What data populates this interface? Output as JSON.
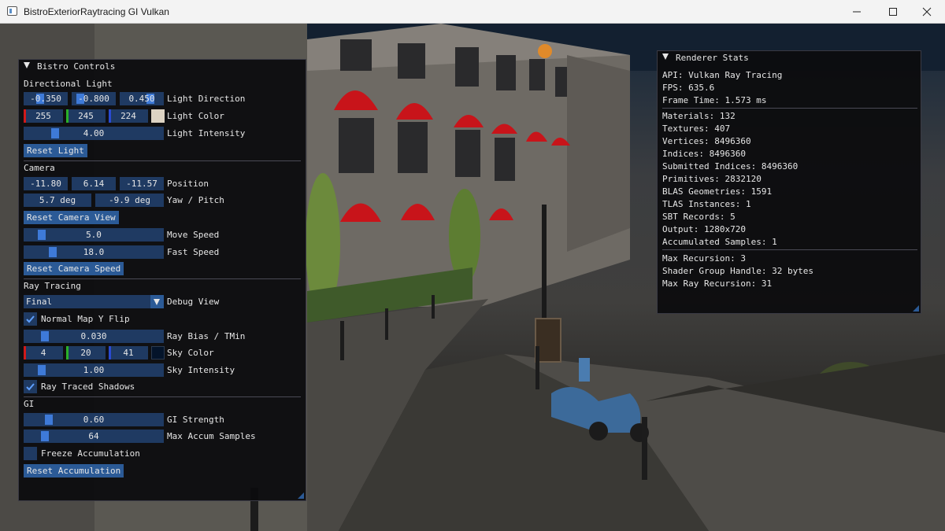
{
  "window": {
    "title": "BistroExteriorRaytracing GI Vulkan"
  },
  "controls": {
    "title": "Bistro Controls",
    "directional_light": {
      "header": "Directional Light",
      "direction": [
        "-0.350",
        "-0.800",
        "0.450"
      ],
      "direction_label": "Light Direction",
      "color": [
        "255",
        "245",
        "224"
      ],
      "color_label": "Light Color",
      "color_swatch": "#ddd3c3",
      "intensity": "4.00",
      "intensity_label": "Light Intensity",
      "reset": "Reset Light"
    },
    "camera": {
      "header": "Camera",
      "position": [
        "-11.80",
        "6.14",
        "-11.57"
      ],
      "position_label": "Position",
      "yaw": "5.7 deg",
      "pitch": "-9.9 deg",
      "yaw_pitch_label": "Yaw / Pitch",
      "reset_view": "Reset Camera View",
      "move_speed": "5.0",
      "move_speed_label": "Move Speed",
      "fast_speed": "18.0",
      "fast_speed_label": "Fast Speed",
      "reset_speed": "Reset Camera Speed"
    },
    "ray_tracing": {
      "header": "Ray Tracing",
      "debug_view_value": "Final",
      "debug_view_label": "Debug View",
      "normal_flip_label": "Normal Map Y Flip",
      "normal_flip_checked": true,
      "ray_bias": "0.030",
      "ray_bias_label": "Ray Bias / TMin",
      "sky_color": [
        "4",
        "20",
        "41"
      ],
      "sky_color_label": "Sky Color",
      "sky_swatch": "#04142a",
      "sky_intensity": "1.00",
      "sky_intensity_label": "Sky Intensity",
      "shadows_label": "Ray Traced Shadows",
      "shadows_checked": true
    },
    "gi": {
      "header": "GI",
      "strength": "0.60",
      "strength_label": "GI Strength",
      "max_accum": "64",
      "max_accum_label": "Max Accum Samples",
      "freeze_label": "Freeze Accumulation",
      "freeze_checked": false,
      "reset": "Reset Accumulation"
    }
  },
  "stats": {
    "title": "Renderer Stats",
    "group1": [
      "API: Vulkan Ray Tracing",
      "FPS: 635.6",
      "Frame Time: 1.573 ms"
    ],
    "group2": [
      "Materials: 132",
      "Textures: 407",
      "Vertices: 8496360",
      "Indices: 8496360",
      "Submitted Indices: 8496360",
      "Primitives: 2832120",
      "BLAS Geometries: 1591",
      "TLAS Instances: 1",
      "SBT Records: 5",
      "Output: 1280x720",
      "Accumulated Samples: 1"
    ],
    "group3": [
      "Max Recursion: 3",
      "Shader Group Handle: 32 bytes",
      "Max Ray Recursion: 31"
    ]
  },
  "colors": {
    "accent": "#2b5a96",
    "frame_bg": "#1f3a62",
    "grab": "#3e7ad8",
    "awning": "#c8141a"
  }
}
